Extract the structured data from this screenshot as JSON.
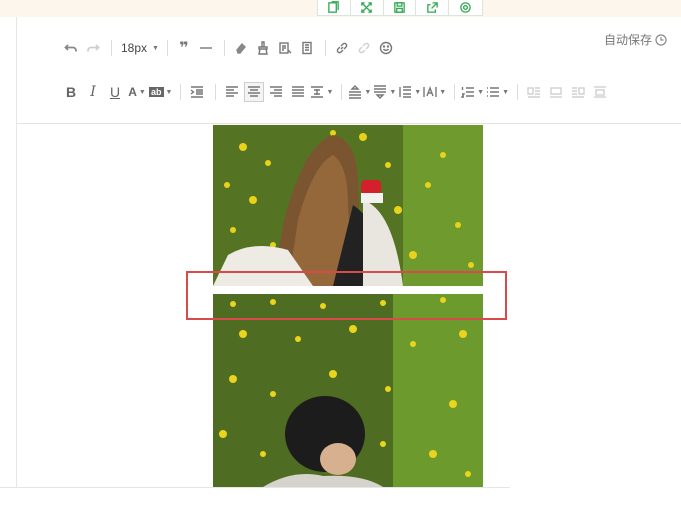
{
  "editor": {
    "autosave_label": "自动保存",
    "font_size": "18px"
  },
  "toolbar": {
    "row1": [
      "undo-icon",
      "redo-icon",
      "font-size-select",
      "blockquote-icon",
      "horizontal-rule-icon",
      "clear-format-icon",
      "format-brush-icon",
      "paste-text-icon",
      "template-icon",
      "link-icon",
      "unlink-icon",
      "emoji-icon"
    ],
    "row2": [
      "bold",
      "italic",
      "underline",
      "font-color",
      "background-color",
      "indent",
      "align-left",
      "align-center",
      "align-right",
      "align-justify",
      "line-spacing",
      "paragraph-before",
      "paragraph-after",
      "paragraph-spacing",
      "letter-spacing",
      "ordered-list",
      "unordered-list",
      "image-float-left",
      "image-float-none",
      "image-float-right",
      "image-center"
    ],
    "bold_label": "B",
    "italic_label": "I",
    "underline_label": "U",
    "font_color_label": "A",
    "bg_color_label": "ab"
  },
  "floating_bar": [
    "copy-icon",
    "fullscreen-icon",
    "save-icon",
    "export-icon",
    "settings-icon"
  ],
  "colors": {
    "accent_green": "#2fa84f",
    "highlight_red": "#d94b4b"
  }
}
